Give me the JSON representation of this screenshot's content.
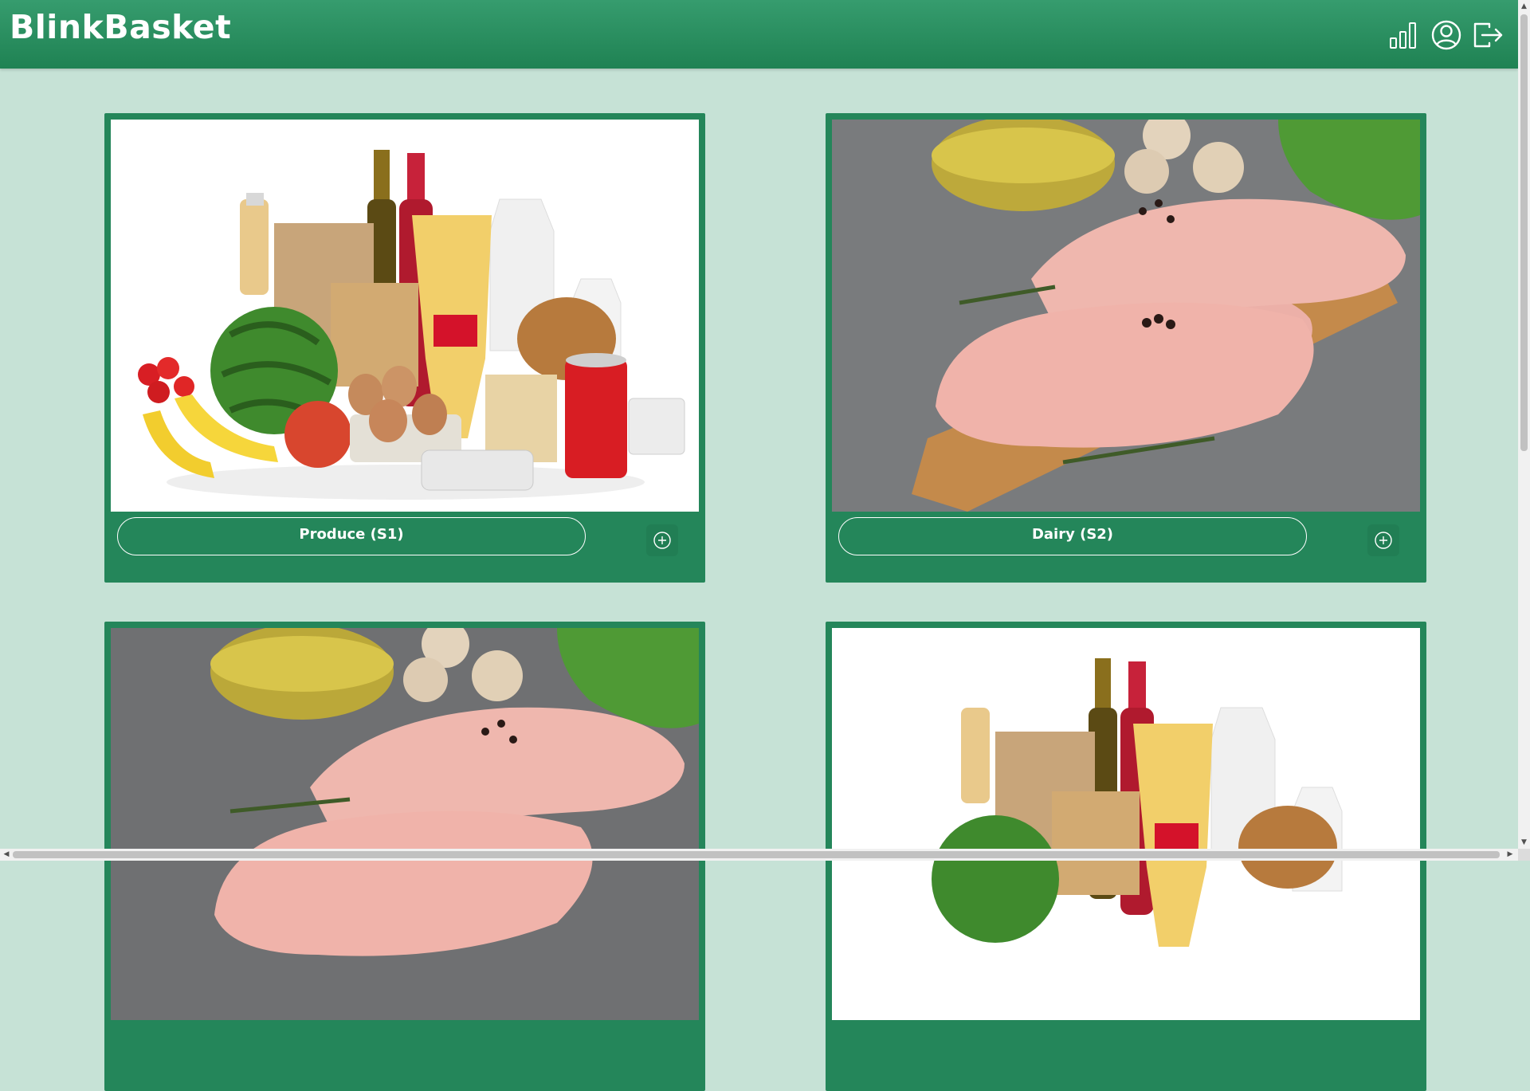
{
  "app": {
    "brand": "BlinkBasket"
  },
  "header": {
    "icons": [
      "bar-chart-icon",
      "user-account-icon",
      "logout-icon"
    ]
  },
  "categories": [
    {
      "label": "Produce (S1)",
      "image": "grocery-assortment-photo"
    },
    {
      "label": "Dairy (S2)",
      "image": "raw-chicken-breast-photo"
    },
    {
      "label": "",
      "image": "raw-chicken-breast-photo"
    },
    {
      "label": "",
      "image": "grocery-assortment-photo"
    }
  ],
  "colors": {
    "header": "#2a8f60",
    "card": "#24865a",
    "background": "#c6e2d6"
  }
}
